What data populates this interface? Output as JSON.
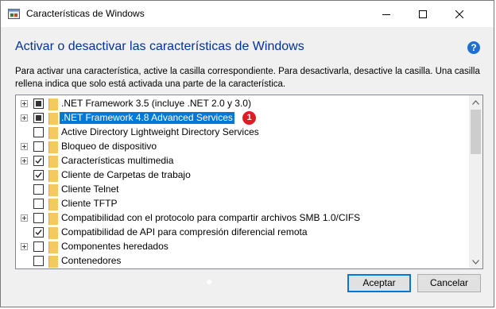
{
  "window": {
    "title": "Características de Windows",
    "heading": "Activar o desactivar las características de Windows",
    "description": "Para activar una característica, active la casilla correspondiente. Para desactivarla, desactive la casilla. Una casilla rellena indica que solo está activada una parte de la característica.",
    "help_icon_text": "?"
  },
  "features": [
    {
      "label": ".NET Framework 3.5 (incluye .NET 2.0 y 3.0)",
      "state": "partial",
      "expandable": true,
      "selected": false
    },
    {
      "label": ".NET Framework 4.8 Advanced Services",
      "state": "partial",
      "expandable": true,
      "selected": true,
      "badge": "1"
    },
    {
      "label": "Active Directory Lightweight Directory Services",
      "state": "unchecked",
      "expandable": false,
      "selected": false
    },
    {
      "label": "Bloqueo de dispositivo",
      "state": "unchecked",
      "expandable": true,
      "selected": false
    },
    {
      "label": "Características multimedia",
      "state": "checked",
      "expandable": true,
      "selected": false
    },
    {
      "label": "Cliente de Carpetas de trabajo",
      "state": "checked",
      "expandable": false,
      "selected": false
    },
    {
      "label": "Cliente Telnet",
      "state": "unchecked",
      "expandable": false,
      "selected": false
    },
    {
      "label": "Cliente TFTP",
      "state": "unchecked",
      "expandable": false,
      "selected": false
    },
    {
      "label": "Compatibilidad con el protocolo para compartir archivos SMB 1.0/CIFS",
      "state": "unchecked",
      "expandable": true,
      "selected": false
    },
    {
      "label": "Compatibilidad de API para compresión diferencial remota",
      "state": "checked",
      "expandable": false,
      "selected": false
    },
    {
      "label": "Componentes heredados",
      "state": "unchecked",
      "expandable": true,
      "selected": false
    },
    {
      "label": "Contenedores",
      "state": "unchecked",
      "expandable": false,
      "selected": false
    }
  ],
  "buttons": {
    "accept": "Aceptar",
    "cancel": "Cancelar"
  },
  "colors": {
    "heading": "#003399",
    "selection": "#0078d7",
    "badge": "#e01b24",
    "help": "#1e6fd0"
  }
}
